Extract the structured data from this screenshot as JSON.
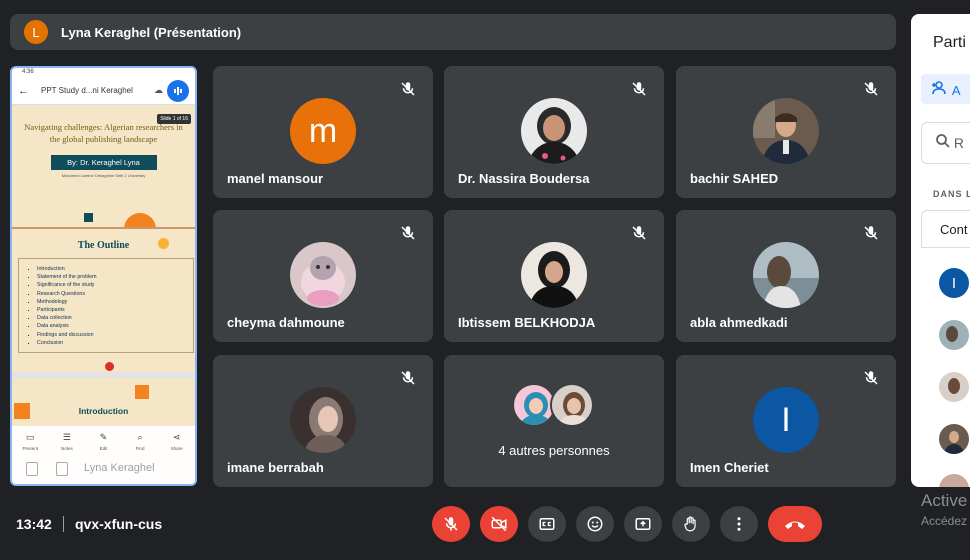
{
  "presenter": {
    "avatar_letter": "L",
    "label": "Lyna Keraghel (Présentation)"
  },
  "phone": {
    "status_time": "4:36",
    "doc_title": "PPT Study d...ni Keraghel",
    "slide_badge": "Slide 1 of 16",
    "slide_title": "Navigating challenges: Algerian researchers in the global publishing landscape",
    "slide_author": "By: Dr. Keraghel Lyna",
    "slide_affiliation": "Mohamed Lamine Debaghine Setif 2 University",
    "outline_title": "The Outline",
    "outline_items": [
      "Introduction",
      "Statement of the problem",
      "Significance of the study",
      "Research Questions",
      "Methodology",
      "Participants",
      "Data collection",
      "Data analysis",
      "Findings and discussion",
      "Conclusion"
    ],
    "next_title": "Introduction",
    "tools": [
      {
        "icon": "present-icon",
        "label": "Present"
      },
      {
        "icon": "notes-icon",
        "label": "Notes"
      },
      {
        "icon": "edit-icon",
        "label": "Edit"
      },
      {
        "icon": "find-icon",
        "label": "Find"
      },
      {
        "icon": "share-icon",
        "label": "Share"
      }
    ],
    "owner_label": "Lyna Keraghel"
  },
  "participants": [
    {
      "name": "manel mansour",
      "avatar_letter": "m",
      "avatar_color": "#e8710a",
      "muted": true
    },
    {
      "name": "Dr. Nassira Boudersa",
      "avatar": "photo",
      "muted": true
    },
    {
      "name": "bachir SAHED",
      "avatar": "photo",
      "muted": true
    },
    {
      "name": "cheyma dahmoune",
      "avatar": "photo",
      "muted": true
    },
    {
      "name": "Ibtissem BELKHODJA",
      "avatar": "photo",
      "muted": true
    },
    {
      "name": "abla ahmedkadi",
      "avatar": "photo",
      "muted": true
    },
    {
      "name": "imane berrabah",
      "avatar": "photo",
      "muted": true
    },
    {
      "name": "Imen Cheriet",
      "avatar_letter": "I",
      "avatar_color": "#0b57a4",
      "muted": true
    }
  ],
  "others": {
    "label": "4 autres personnes"
  },
  "side_panel": {
    "title": "Parti",
    "add_label": "A",
    "search_placeholder": "R",
    "section_label": "DANS L",
    "contrib_label": "Cont",
    "first_avatar_letter": "I",
    "first_avatar_color": "#0b57a4"
  },
  "meeting": {
    "time": "13:42",
    "code": "qvx-xfun-cus"
  },
  "controls": [
    {
      "icon": "mic-off-icon",
      "state": "off"
    },
    {
      "icon": "camera-off-icon",
      "state": "off"
    },
    {
      "icon": "captions-icon"
    },
    {
      "icon": "emoji-icon"
    },
    {
      "icon": "present-now-icon"
    },
    {
      "icon": "raise-hand-icon"
    },
    {
      "icon": "more-options-icon"
    },
    {
      "icon": "end-call-icon"
    }
  ],
  "watermark": {
    "line1": "Active",
    "line2": "Accédez"
  },
  "colors": {
    "background": "#202124",
    "tile": "#3c4043",
    "danger": "#ea4335",
    "accent": "#8ab4f8"
  }
}
